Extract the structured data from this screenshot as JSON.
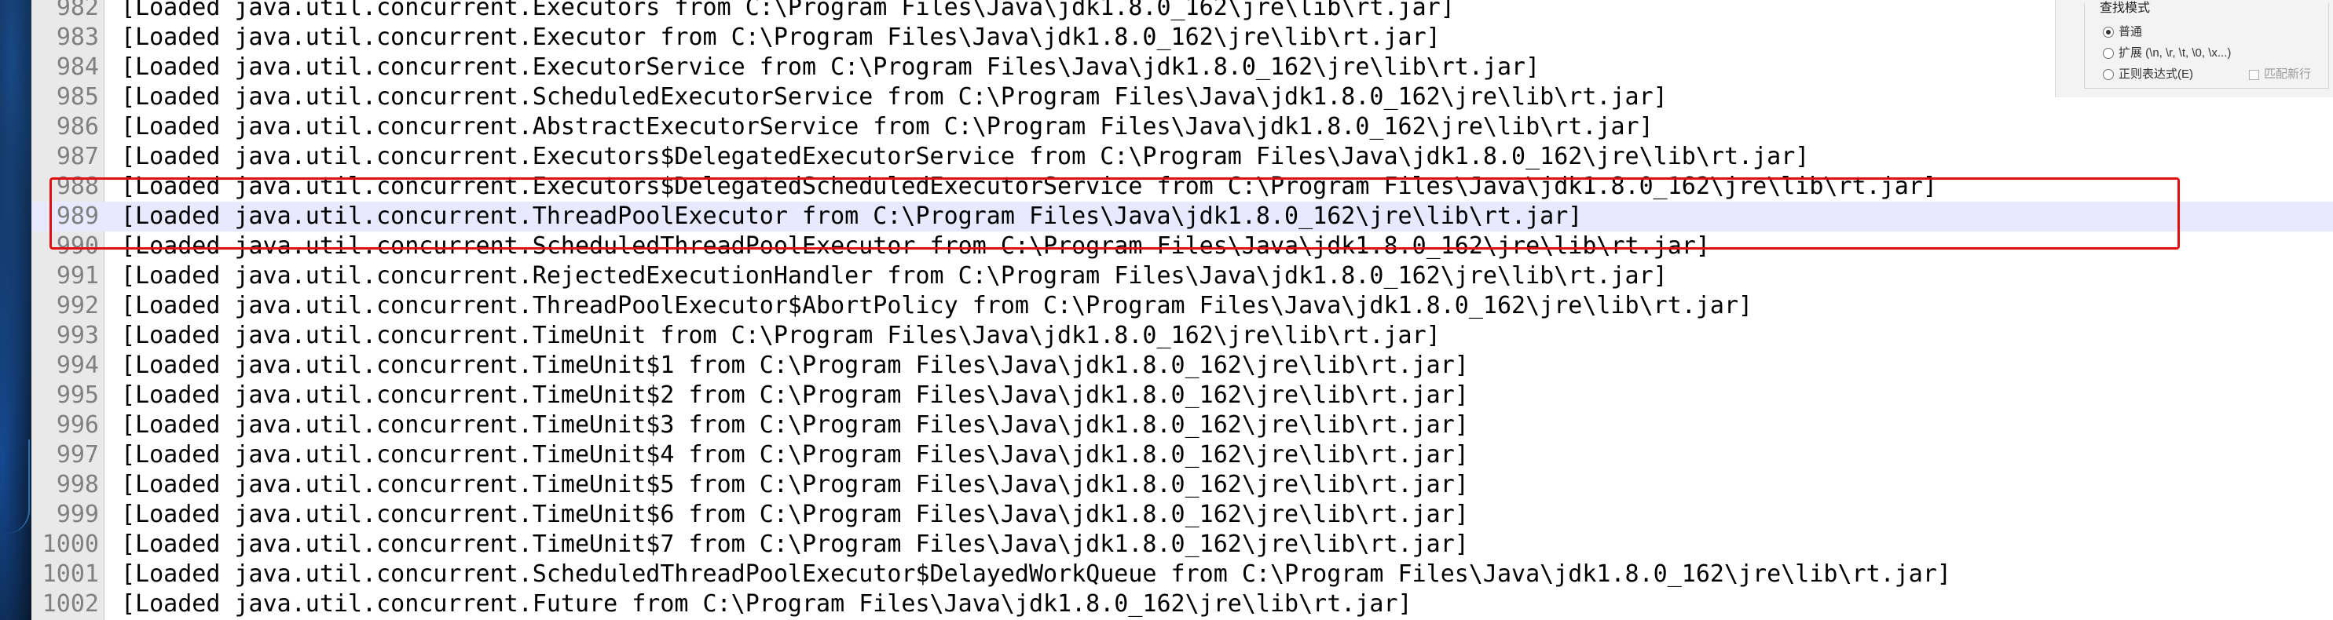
{
  "editor": {
    "lines": [
      {
        "no": "982",
        "text": "[Loaded java.util.concurrent.Executors from C:\\Program Files\\Java\\jdk1.8.0_162\\jre\\lib\\rt.jar]"
      },
      {
        "no": "983",
        "text": "[Loaded java.util.concurrent.Executor from C:\\Program Files\\Java\\jdk1.8.0_162\\jre\\lib\\rt.jar]"
      },
      {
        "no": "984",
        "text": "[Loaded java.util.concurrent.ExecutorService from C:\\Program Files\\Java\\jdk1.8.0_162\\jre\\lib\\rt.jar]"
      },
      {
        "no": "985",
        "text": "[Loaded java.util.concurrent.ScheduledExecutorService from C:\\Program Files\\Java\\jdk1.8.0_162\\jre\\lib\\rt.jar]"
      },
      {
        "no": "986",
        "text": "[Loaded java.util.concurrent.AbstractExecutorService from C:\\Program Files\\Java\\jdk1.8.0_162\\jre\\lib\\rt.jar]"
      },
      {
        "no": "987",
        "text": "[Loaded java.util.concurrent.Executors$DelegatedExecutorService from C:\\Program Files\\Java\\jdk1.8.0_162\\jre\\lib\\rt.jar]"
      },
      {
        "no": "988",
        "text": "[Loaded java.util.concurrent.Executors$DelegatedScheduledExecutorService from C:\\Program Files\\Java\\jdk1.8.0_162\\jre\\lib\\rt.jar]"
      },
      {
        "no": "989",
        "text": "[Loaded java.util.concurrent.ThreadPoolExecutor from C:\\Program Files\\Java\\jdk1.8.0_162\\jre\\lib\\rt.jar]"
      },
      {
        "no": "990",
        "text": "[Loaded java.util.concurrent.ScheduledThreadPoolExecutor from C:\\Program Files\\Java\\jdk1.8.0_162\\jre\\lib\\rt.jar]"
      },
      {
        "no": "991",
        "text": "[Loaded java.util.concurrent.RejectedExecutionHandler from C:\\Program Files\\Java\\jdk1.8.0_162\\jre\\lib\\rt.jar]"
      },
      {
        "no": "992",
        "text": "[Loaded java.util.concurrent.ThreadPoolExecutor$AbortPolicy from C:\\Program Files\\Java\\jdk1.8.0_162\\jre\\lib\\rt.jar]"
      },
      {
        "no": "993",
        "text": "[Loaded java.util.concurrent.TimeUnit from C:\\Program Files\\Java\\jdk1.8.0_162\\jre\\lib\\rt.jar]"
      },
      {
        "no": "994",
        "text": "[Loaded java.util.concurrent.TimeUnit$1 from C:\\Program Files\\Java\\jdk1.8.0_162\\jre\\lib\\rt.jar]"
      },
      {
        "no": "995",
        "text": "[Loaded java.util.concurrent.TimeUnit$2 from C:\\Program Files\\Java\\jdk1.8.0_162\\jre\\lib\\rt.jar]"
      },
      {
        "no": "996",
        "text": "[Loaded java.util.concurrent.TimeUnit$3 from C:\\Program Files\\Java\\jdk1.8.0_162\\jre\\lib\\rt.jar]"
      },
      {
        "no": "997",
        "text": "[Loaded java.util.concurrent.TimeUnit$4 from C:\\Program Files\\Java\\jdk1.8.0_162\\jre\\lib\\rt.jar]"
      },
      {
        "no": "998",
        "text": "[Loaded java.util.concurrent.TimeUnit$5 from C:\\Program Files\\Java\\jdk1.8.0_162\\jre\\lib\\rt.jar]"
      },
      {
        "no": "999",
        "text": "[Loaded java.util.concurrent.TimeUnit$6 from C:\\Program Files\\Java\\jdk1.8.0_162\\jre\\lib\\rt.jar]"
      },
      {
        "no": "1000",
        "text": "[Loaded java.util.concurrent.TimeUnit$7 from C:\\Program Files\\Java\\jdk1.8.0_162\\jre\\lib\\rt.jar]"
      },
      {
        "no": "1001",
        "text": "[Loaded java.util.concurrent.ScheduledThreadPoolExecutor$DelayedWorkQueue from C:\\Program Files\\Java\\jdk1.8.0_162\\jre\\lib\\rt.jar]"
      },
      {
        "no": "1002",
        "text": "[Loaded java.util.concurrent.Future from C:\\Program Files\\Java\\jdk1.8.0_162\\jre\\lib\\rt.jar]"
      }
    ],
    "current_line": "989",
    "current_line_color": "#e8e8ff",
    "highlight_color": "#e01010"
  },
  "find_panel": {
    "group_title": "查找模式",
    "mode_normal": "普通",
    "mode_extended": "扩展 (\\n, \\r, \\t, \\0, \\x...)",
    "mode_regex": "正则表达式(E)",
    "match_newline": "匹配新行",
    "selected_mode": "普通"
  }
}
